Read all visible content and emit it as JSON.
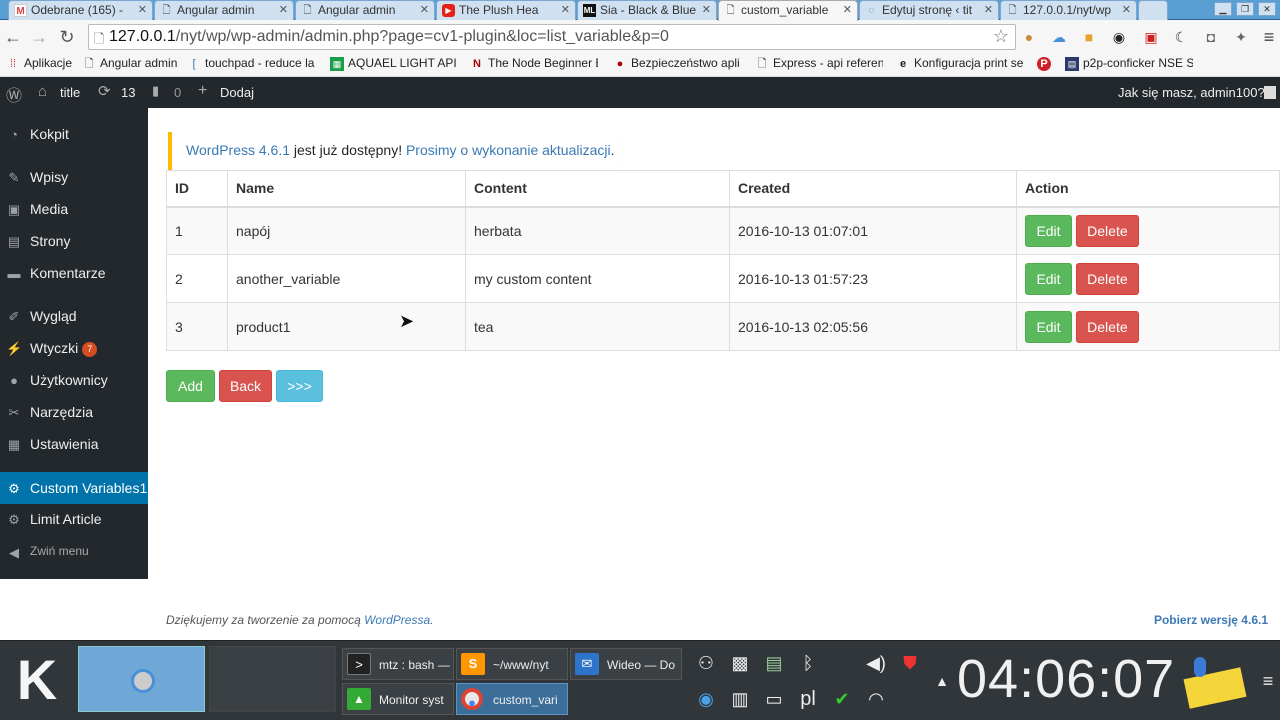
{
  "browser": {
    "tabs": [
      {
        "title": "Odebrane (165) - ",
        "icon": "gmail-icon"
      },
      {
        "title": "Angular admin",
        "icon": "page-icon"
      },
      {
        "title": "Angular admin",
        "icon": "page-icon"
      },
      {
        "title": "The Plush Hea",
        "icon": "youtube-icon"
      },
      {
        "title": "Sia - Black & Blue",
        "icon": "music-icon"
      },
      {
        "title": "custom_variable",
        "icon": "page-icon"
      },
      {
        "title": "Edytuj stronę ‹ tit",
        "icon": "loading-icon"
      },
      {
        "title": "127.0.0.1/nyt/wp",
        "icon": "page-icon"
      }
    ],
    "url_host": "127.0.0.1",
    "url_path": "/nyt/wp/wp-admin/admin.php?page=cv1-plugin&loc=list_variable&p=0",
    "bookmarks": [
      {
        "label": "Aplikacje",
        "icon": "apps-icon"
      },
      {
        "label": "Angular admin",
        "icon": "page-icon"
      },
      {
        "label": "touchpad - reduce la",
        "icon": "page-icon"
      },
      {
        "label": "AQUAEL LIGHT API - ",
        "icon": "sheet-icon"
      },
      {
        "label": "The Node Beginner B",
        "icon": "n-icon"
      },
      {
        "label": "Bezpieczeństwo apli",
        "icon": "bomb-icon"
      },
      {
        "label": "Express - api referen",
        "icon": "page-icon"
      },
      {
        "label": "Konfiguracja print se",
        "icon": "e-icon"
      },
      {
        "label": "",
        "icon": "pinterest-icon"
      },
      {
        "label": "p2p-conficker NSE S",
        "icon": "script-icon"
      }
    ]
  },
  "adminbar": {
    "site_title": "title",
    "updates_count": "13",
    "comments_count": "0",
    "add_label": "Dodaj",
    "greeting": "Jak się masz, admin100?"
  },
  "sidebar": {
    "items": [
      {
        "label": "Kokpit",
        "icon": "dashboard-icon"
      },
      {
        "label": "Wpisy",
        "icon": "pin-icon"
      },
      {
        "label": "Media",
        "icon": "media-icon"
      },
      {
        "label": "Strony",
        "icon": "pages-icon"
      },
      {
        "label": "Komentarze",
        "icon": "comments-icon"
      },
      {
        "label": "Wygląd",
        "icon": "brush-icon"
      },
      {
        "label": "Wtyczki",
        "icon": "plugin-icon",
        "badge": "7"
      },
      {
        "label": "Użytkownicy",
        "icon": "user-icon"
      },
      {
        "label": "Narzędzia",
        "icon": "wrench-icon"
      },
      {
        "label": "Ustawienia",
        "icon": "settings-icon"
      },
      {
        "label": "Custom Variables1",
        "icon": "gear-icon",
        "current": true
      },
      {
        "label": "Limit Article",
        "icon": "gear-icon"
      }
    ],
    "collapse_label": "Zwiń menu"
  },
  "notice": {
    "version_link": "WordPress 4.6.1",
    "middle": " jest już dostępny! ",
    "update_link": "Prosimy o wykonanie aktualizacji",
    "end": "."
  },
  "table": {
    "headers": [
      "ID",
      "Name",
      "Content",
      "Created",
      "Action"
    ],
    "rows": [
      {
        "id": "1",
        "name": "napój",
        "content": "herbata",
        "created": "2016-10-13 01:07:01"
      },
      {
        "id": "2",
        "name": "another_variable",
        "content": "my custom content",
        "created": "2016-10-13 01:57:23"
      },
      {
        "id": "3",
        "name": "product1",
        "content": "tea",
        "created": "2016-10-13 02:05:56"
      }
    ],
    "edit_label": "Edit",
    "delete_label": "Delete"
  },
  "actions": {
    "add": "Add",
    "back": "Back",
    "next": ">>>"
  },
  "footer": {
    "thanks_prefix": "Dziękujemy za tworzenie za pomocą ",
    "wp_link": "WordPressa",
    "thanks_suffix": ".",
    "version": "Pobierz wersję 4.6.1"
  },
  "taskbar": {
    "tasks": [
      {
        "label": "mtz : bash —",
        "icon": "terminal-icon"
      },
      {
        "label": "~/www/nyt",
        "icon": "sublime-icon"
      },
      {
        "label": "Wideo — Do",
        "icon": "mail-icon"
      },
      {
        "label": "Monitor syst",
        "icon": "monitor-icon"
      },
      {
        "label": "custom_vari",
        "icon": "chrome-icon"
      }
    ],
    "keyboard_layout": "pl",
    "clock": "04:06:07"
  },
  "colors": {
    "accent": "#0073aa",
    "admin_bg": "#23282d",
    "notice_border": "#ffb900"
  }
}
